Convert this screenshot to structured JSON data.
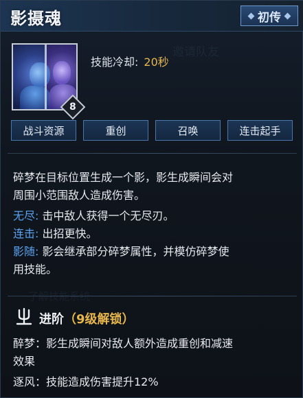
{
  "skill": {
    "name": "影摄魂",
    "tier": "初传",
    "level": "8",
    "cooldown_label": "技能冷却:",
    "cooldown_value": "20秒"
  },
  "tags": [
    "战斗资源",
    "重创",
    "召唤",
    "连击起手"
  ],
  "description": {
    "line1": "碎梦在目标位置生成一个影，影生成瞬间会对",
    "line2": "周围小范围敌人造成伤害。",
    "effects": [
      {
        "key": "无尽",
        "sep": ":",
        "text": "击中敌人获得一个无尽刃。"
      },
      {
        "key": "连击",
        "sep": ":",
        "text": "出招更快。"
      },
      {
        "key": "影随",
        "sep": ":",
        "text": "影会继承部分碎梦属性，并模仿碎梦使"
      }
    ],
    "line_tail": "用技能。"
  },
  "advancement": {
    "title": "进阶",
    "unlock": "（9级解锁）",
    "entries": [
      {
        "line1": "醉梦：影生成瞬间对敌人额外造成重创和减速",
        "line2": "效果"
      },
      {
        "line1": "逐风：技能造成伤害提升12%"
      }
    ]
  },
  "colors": {
    "accent_blue": "#5aa3f0",
    "accent_gold": "#e7b64e",
    "text": "#e6e9ee"
  }
}
